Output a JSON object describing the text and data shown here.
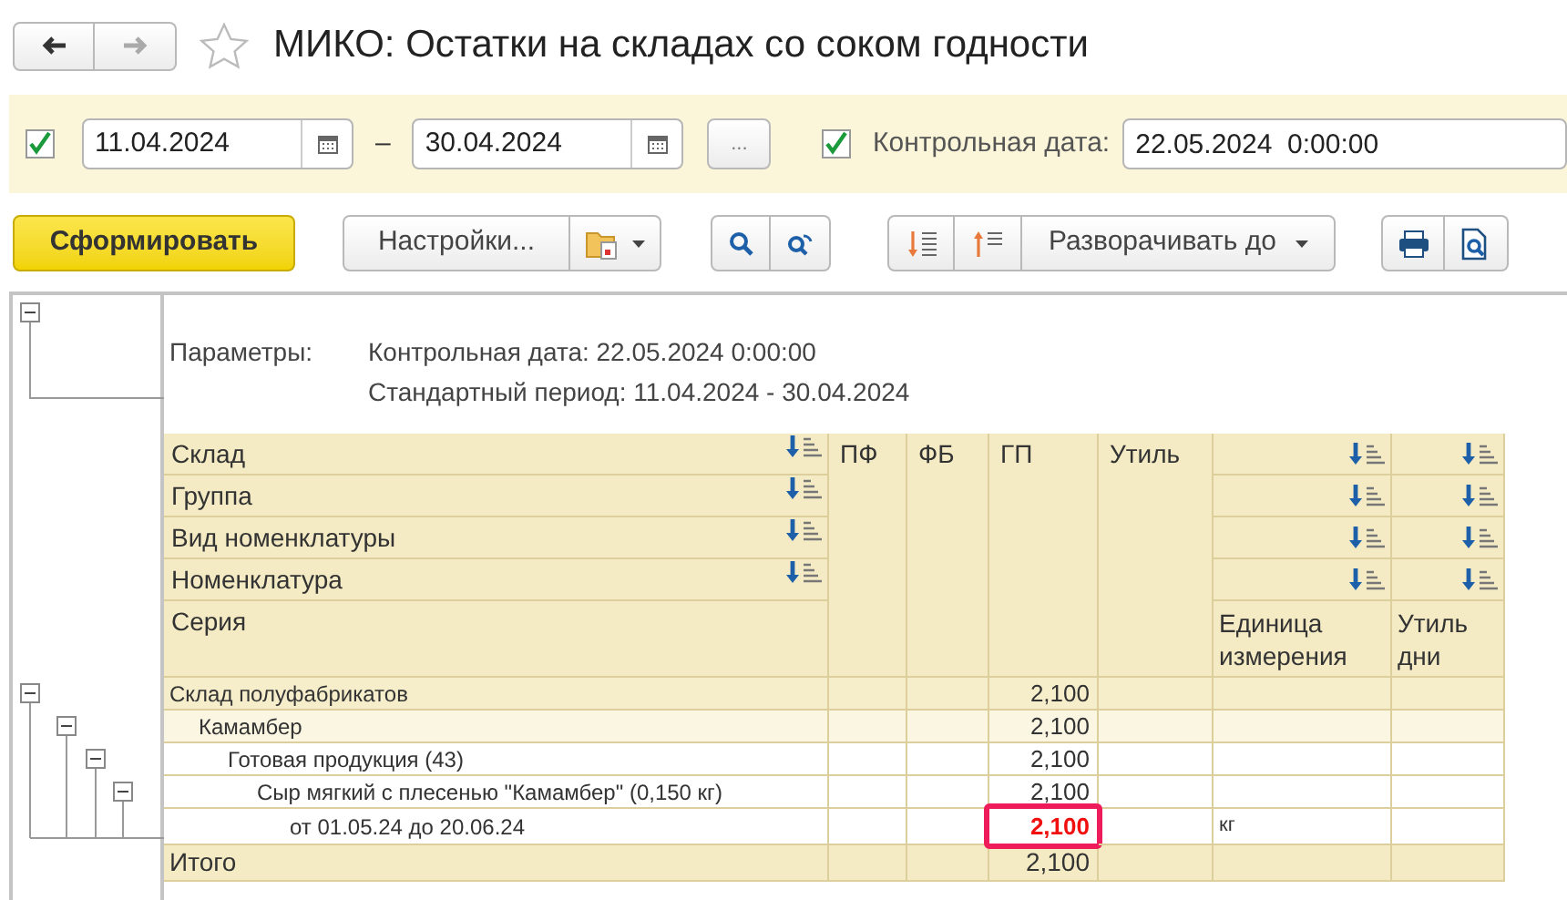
{
  "nav": [
    {
      "kind": "back",
      "disabled": false
    },
    {
      "kind": "forward",
      "disabled": true
    }
  ],
  "favorite": {
    "checked": false
  },
  "title": "МИКО: Остатки на складах со соком годности",
  "period": {
    "checked": true,
    "start": "11.04.2024",
    "dash": "–",
    "end": "30.04.2024",
    "more": "..."
  },
  "control_date": {
    "checked": true,
    "label": "Контрольная дата:",
    "value": "22.05.2024  0:00:00"
  },
  "toolbar": {
    "generate": "Сформировать",
    "settings": "Настройки...",
    "expand_to": "Разворачивать до"
  },
  "report": {
    "parameters_expanded": true,
    "parameters_label": "Параметры:",
    "parameters": [
      "Контрольная дата: 22.05.2024 0:00:00",
      "Стандартный период: 11.04.2024 - 30.04.2024"
    ],
    "row_headers": [
      {
        "label": "Склад",
        "sortable": true
      },
      {
        "label": "Группа",
        "sortable": true
      },
      {
        "label": "Вид номенклатуры",
        "sortable": true
      },
      {
        "label": "Номенклатура",
        "sortable": true
      },
      {
        "label": "Серия",
        "sortable": false
      }
    ],
    "columns": [
      {
        "kind": "measure",
        "label": "ПФ"
      },
      {
        "kind": "measure",
        "label": "ФБ"
      },
      {
        "kind": "measure",
        "label": "ГП"
      },
      {
        "kind": "measure",
        "label": "Утиль"
      },
      {
        "kind": "attribute",
        "label": "Единица измерения"
      },
      {
        "kind": "attribute",
        "label": "Утиль дни"
      }
    ],
    "rows": [
      {
        "label": "Склад полуфабрикатов",
        "gp": "2,100",
        "expanded": true,
        "children": [
          {
            "label": "Камамбер",
            "gp": "2,100",
            "expanded": true,
            "children": [
              {
                "label": "Готовая продукция (43)",
                "gp": "2,100",
                "expanded": true,
                "children": [
                  {
                    "label": "Сыр мягкий с плесенью \"Камамбер\" (0,150 кг)",
                    "gp": "2,100",
                    "expanded": true,
                    "children": [
                      {
                        "label": "от 01.05.24 до 20.06.24",
                        "gp": "2,100",
                        "unit": "кг",
                        "highlighted": true
                      }
                    ]
                  }
                ]
              }
            ]
          }
        ]
      }
    ],
    "total": {
      "label": "Итого",
      "gp": "2,100"
    }
  }
}
